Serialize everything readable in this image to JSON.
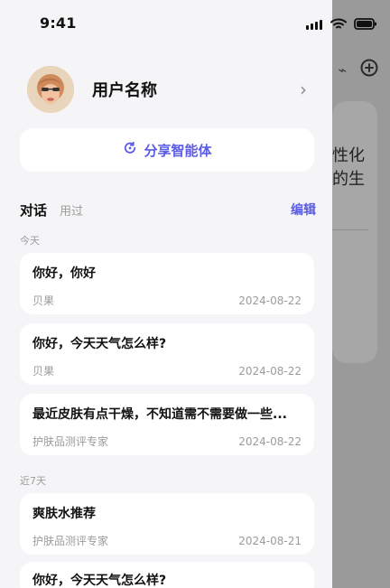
{
  "status": {
    "time": "9:41"
  },
  "drawer": {
    "user_name": "用户名称",
    "share_label": "分享智能体",
    "tabs": [
      {
        "label": "对话"
      },
      {
        "label": "用过"
      }
    ],
    "edit_label": "编辑",
    "sections": {
      "today": "今天",
      "last7": "近7天"
    },
    "today_items": [
      {
        "title": "你好，你好",
        "source": "贝果",
        "date": "2024-08-22"
      },
      {
        "title": "你好，今天天气怎么样?",
        "source": "贝果",
        "date": "2024-08-22"
      },
      {
        "title": "最近皮肤有点干燥，不知道需不需要做一些...",
        "source": "护肤品测评专家",
        "date": "2024-08-22"
      }
    ],
    "last7_items": [
      {
        "title": "爽肤水推荐",
        "source": "护肤品测评专家",
        "date": "2024-08-21"
      },
      {
        "title": "你好，今天天气怎么样?",
        "source": "",
        "date": ""
      }
    ]
  },
  "background": {
    "card_text_line1": "性化",
    "card_text_line2": "的生"
  },
  "colors": {
    "accent": "#5b5ce6",
    "drawer_bg": "#f5f5f7",
    "overlay": "#9a9a9a"
  },
  "icons": {
    "signal": "signal-icon",
    "wifi": "wifi-icon",
    "battery": "battery-icon",
    "share": "share-icon",
    "chevron": "chevron-right-icon",
    "add": "plus-circle-icon"
  }
}
